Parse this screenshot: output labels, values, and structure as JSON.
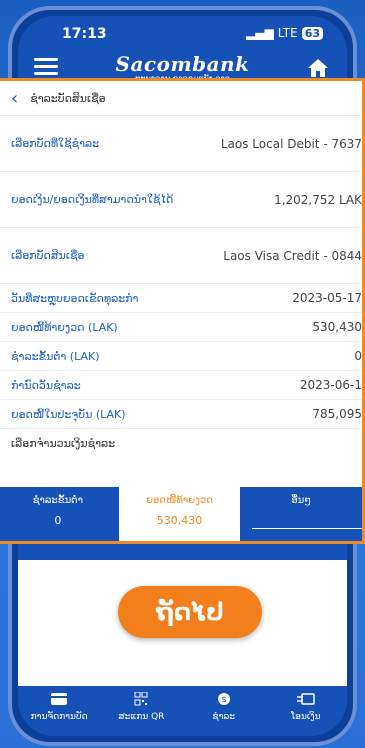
{
  "status": {
    "time": "17:13",
    "network": "LTE",
    "battery": "63"
  },
  "brand": {
    "name": "Sacombank",
    "tagline": "ທະນາຄານ ຊາຄອມແບັງ ລາວ"
  },
  "screen": {
    "title": "ຊຳລະບັດສິນເຊື່ອ"
  },
  "rows": [
    {
      "label": "ເລືອກບັດທີ່ໃຊ້ຊຳລະ",
      "value": "Laos Local Debit - 7637 ",
      "size": "tall"
    },
    {
      "label": "ຍອດເງິນ/ຍອດເງິນທີ່ສາມາດນຳໃຊ້ໄດ້",
      "value": "1,202,752 LAK",
      "size": "tall"
    },
    {
      "label": "ເລືອກບັດສິນເຊື່ອ",
      "value": "Laos Visa Credit - 0844 ",
      "size": "tall"
    },
    {
      "label": "ວັນທີ່ສະຫຼຸບຍອດເຂັດທຸລະກຳ",
      "value": "2023-05-17",
      "size": "short"
    },
    {
      "label": "ຍອດໜີ້ທ້າຍງວດ (LAK)",
      "value": "530,430",
      "size": "short"
    },
    {
      "label": "ຊຳລະຂັ້ນຕ່ຳ (LAK)",
      "value": "0",
      "size": "short"
    },
    {
      "label": "ກຳນົດວັນຊຳລະ",
      "value": "2023-06-1",
      "size": "short"
    },
    {
      "label": "ຍອດໜີ້ໃນປະຈຸບັນ (LAK)",
      "value": "785,095",
      "size": "short"
    },
    {
      "label": "ເລືອກຈຳນວນເງິນຊຳລະ",
      "value": "",
      "size": "short"
    }
  ],
  "tabs": [
    {
      "label": "ຊຳລະຂັ້ນຕ່ຳ",
      "amount": "0"
    },
    {
      "label": "ຍອດໜີ້ທ້າຍງວດ",
      "amount": "530,430"
    },
    {
      "label": "ອື່ນໆ",
      "amount": ""
    }
  ],
  "next_button": "ຖັດໄປ",
  "nav": [
    {
      "label": "ການຈັດການບັດ",
      "icon": "card-icon"
    },
    {
      "label": "ສະແກນ QR",
      "icon": "qr-icon"
    },
    {
      "label": "ຊຳລະ",
      "icon": "payment-icon"
    },
    {
      "label": "ໂອນເງິນ",
      "icon": "transfer-icon"
    }
  ]
}
